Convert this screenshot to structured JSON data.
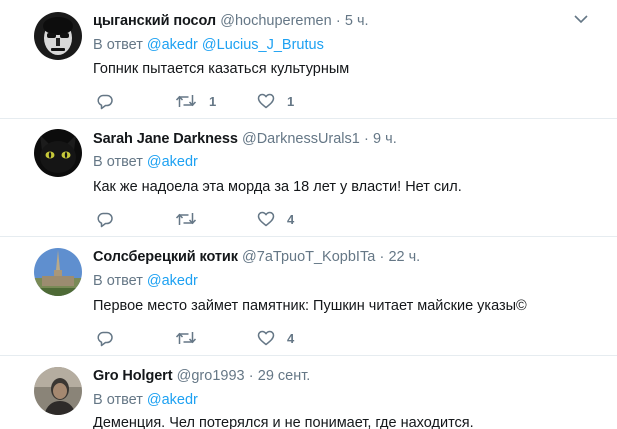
{
  "tweets": [
    {
      "name": "цыганский посол",
      "handle": "@hochuperemen",
      "time": "5 ч.",
      "reply_prefix": "В ответ",
      "mentions": [
        "@akedr",
        "@Lucius_J_Brutus"
      ],
      "text": "Гопник пытается казаться культурным",
      "replies": "",
      "retweets": "1",
      "likes": "1",
      "avatar_icon": "masked-face-avatar"
    },
    {
      "name": "Sarah Jane Darkness",
      "handle": "@DarknessUrals1",
      "time": "9 ч.",
      "reply_prefix": "В ответ",
      "mentions": [
        "@akedr"
      ],
      "text": "Как же надоела эта морда за 18 лет у власти! Нет сил.",
      "replies": "",
      "retweets": "",
      "likes": "4",
      "avatar_icon": "black-cat-avatar"
    },
    {
      "name": "Солсберецкий котик",
      "handle": "@7аТрuoT_KopbITa",
      "time": "22 ч.",
      "reply_prefix": "В ответ",
      "mentions": [
        "@akedr"
      ],
      "text": "Первое место займет памятник: Пушкин читает майские указы©",
      "replies": "",
      "retweets": "",
      "likes": "4",
      "avatar_icon": "cathedral-spire-avatar"
    },
    {
      "name": "Gro Holgert",
      "handle": "@gro1993",
      "time": "29 сент.",
      "reply_prefix": "В ответ",
      "mentions": [
        "@akedr"
      ],
      "text": "Деменция. Чел потерялся и не понимает, где находится.",
      "replies": "",
      "retweets": "",
      "likes": "",
      "avatar_icon": "person-photo-avatar"
    }
  ],
  "separator": "·",
  "colors": {
    "link": "#1da1f2",
    "muted": "#657786",
    "text": "#14171a",
    "divider": "#e6ecf0"
  }
}
